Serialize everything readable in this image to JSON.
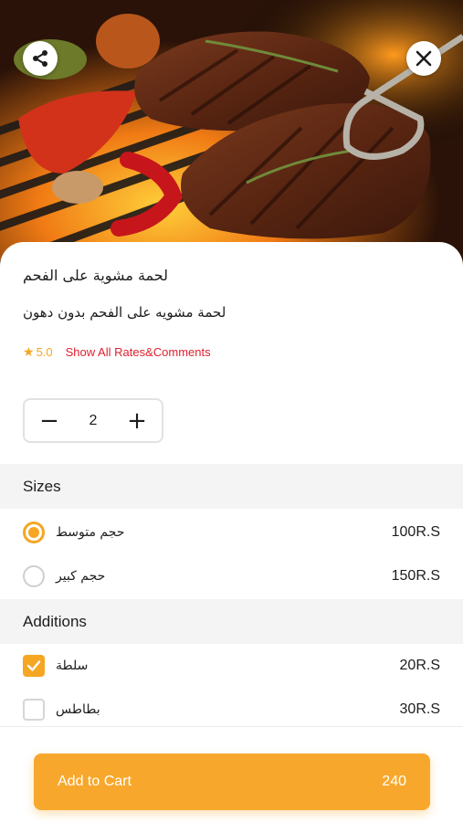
{
  "hero": {
    "image": "grilled-steak-photo",
    "share_icon": "share-icon",
    "close_icon": "close-icon"
  },
  "product": {
    "title": "لحمة مشوية على الفحم",
    "description": "لحمة مشويه على الفحم بدون دهون",
    "rating": "5.0",
    "rates_link": "Show All Rates&Comments"
  },
  "quantity": {
    "minus": "−",
    "value": "2",
    "plus": "+"
  },
  "sizes": {
    "title": "Sizes",
    "options": [
      {
        "label": "حجم متوسط",
        "price": "100R.S",
        "selected": true
      },
      {
        "label": "حجم كبير",
        "price": "150R.S",
        "selected": false
      }
    ]
  },
  "additions": {
    "title": "Additions",
    "options": [
      {
        "label": "سلطة",
        "price": "20R.S",
        "checked": true
      },
      {
        "label": "بطاطس",
        "price": "30R.S",
        "checked": false
      }
    ]
  },
  "cart": {
    "label": "Add to Cart",
    "total": "240"
  },
  "colors": {
    "accent": "#f5a623",
    "link": "#e0202e",
    "section_bg": "#f4f4f4"
  }
}
